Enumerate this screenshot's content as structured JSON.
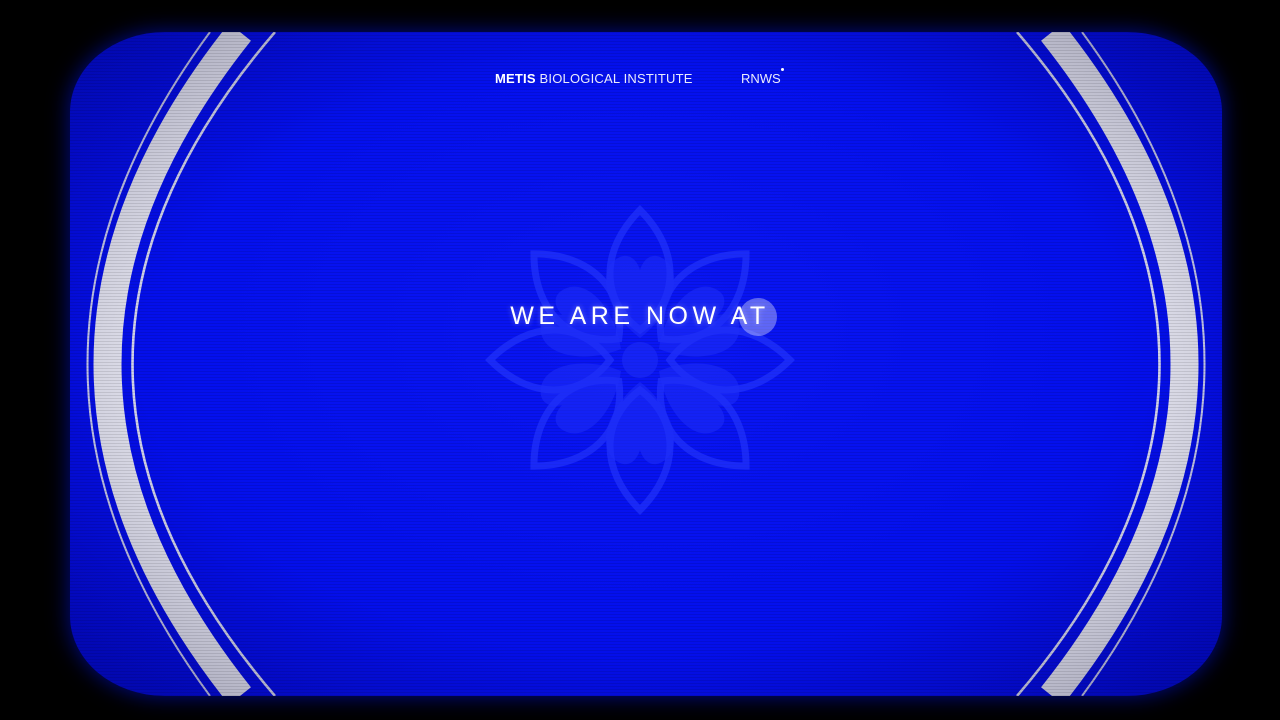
{
  "nav": {
    "brand_strong": "METIS",
    "brand_rest": "BIOLOGICAL INSTITUTE",
    "news_label": "RNWS"
  },
  "hero": {
    "headline": "WE ARE NOW AT"
  },
  "icons": {
    "emblem": "flower-emblem-icon",
    "news_indicator": "dot-icon",
    "cursor": "cursor-circle-icon"
  },
  "colors": {
    "screen_blue": "#0410ee",
    "frame_white": "#e8e8e8",
    "text": "#ffffff",
    "background": "#000000"
  }
}
